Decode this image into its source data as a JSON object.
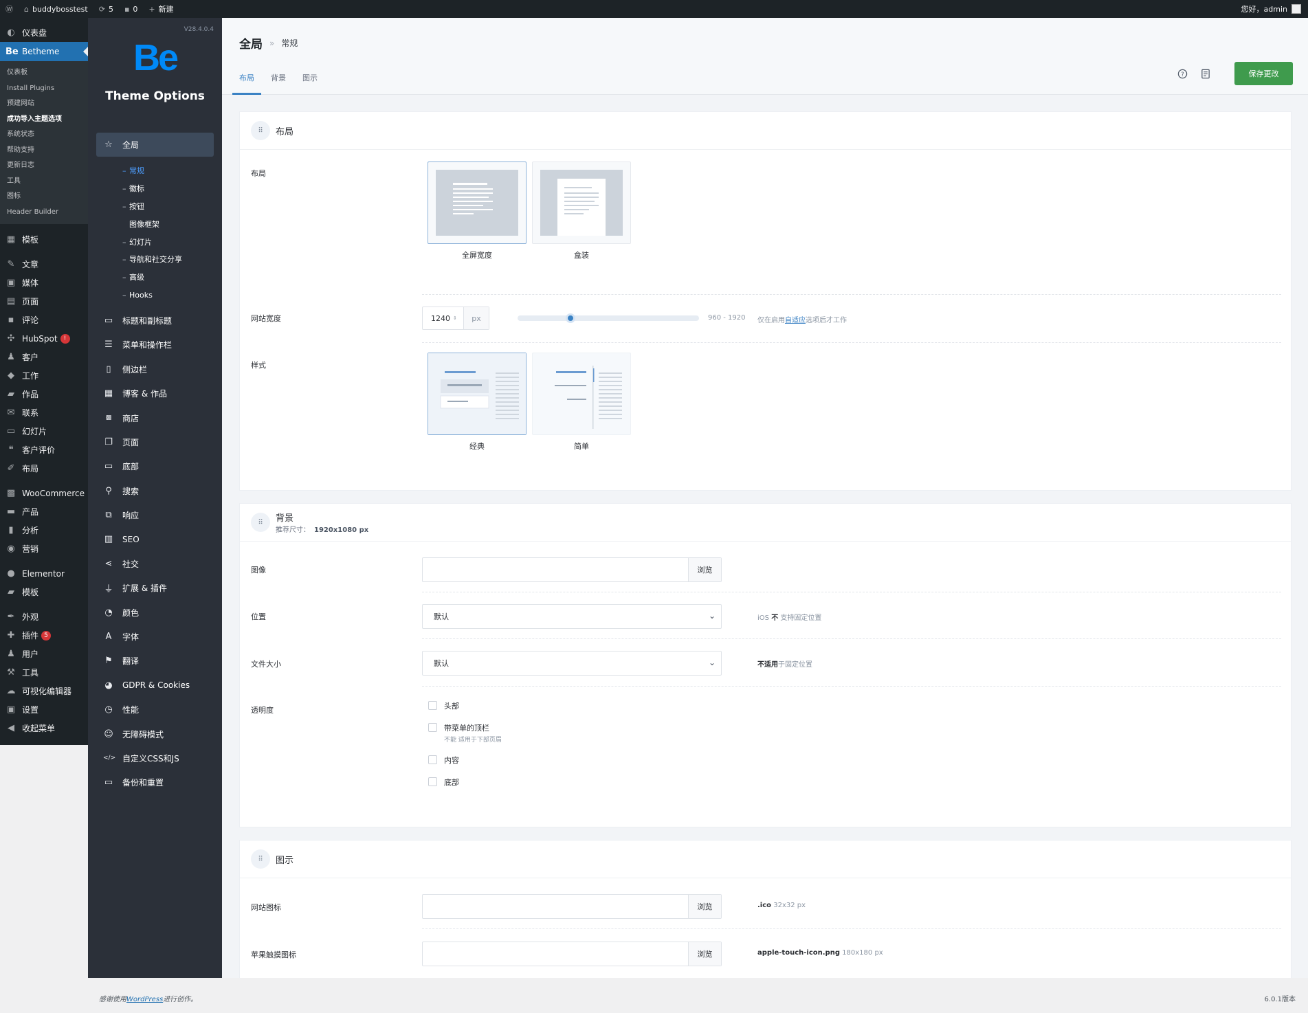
{
  "adminbar": {
    "site_name": "buddybosstest",
    "updates_count": "5",
    "comments_count": "0",
    "new_label": "新建",
    "greeting": "您好，admin"
  },
  "wp_menu": {
    "dashboard": "仪表盘",
    "betheme": "Betheme",
    "betheme_sub": [
      "仪表板",
      "Install Plugins",
      "预建网站",
      "成功导入主题选项",
      "系统状态",
      "帮助支持",
      "更新日志",
      "工具",
      "图标",
      "Header Builder"
    ],
    "group1": [
      {
        "label": "模板",
        "icon": "template-icon"
      }
    ],
    "group2": [
      {
        "label": "文章",
        "icon": "pin-icon"
      },
      {
        "label": "媒体",
        "icon": "media-icon"
      },
      {
        "label": "页面",
        "icon": "page-icon"
      },
      {
        "label": "评论",
        "icon": "comment-icon"
      },
      {
        "label": "HubSpot",
        "icon": "hubspot-icon",
        "badge": "!"
      },
      {
        "label": "客户",
        "icon": "client-icon"
      },
      {
        "label": "工作",
        "icon": "work-icon"
      },
      {
        "label": "作品",
        "icon": "portfolio-icon"
      },
      {
        "label": "联系",
        "icon": "mail-icon"
      },
      {
        "label": "幻灯片",
        "icon": "slides-icon"
      },
      {
        "label": "客户评价",
        "icon": "quote-icon"
      },
      {
        "label": "布局",
        "icon": "layout-icon"
      }
    ],
    "group3": [
      {
        "label": "WooCommerce",
        "icon": "woo-icon"
      },
      {
        "label": "产品",
        "icon": "product-icon"
      },
      {
        "label": "分析",
        "icon": "analytics-icon"
      },
      {
        "label": "营销",
        "icon": "marketing-icon"
      }
    ],
    "group4": [
      {
        "label": "Elementor",
        "icon": "elementor-icon"
      },
      {
        "label": "模板",
        "icon": "folder-icon"
      }
    ],
    "group5": [
      {
        "label": "外观",
        "icon": "brush-icon"
      },
      {
        "label": "插件",
        "icon": "plugin-icon",
        "badge": "5"
      },
      {
        "label": "用户",
        "icon": "user-icon"
      },
      {
        "label": "工具",
        "icon": "wrench-icon"
      },
      {
        "label": "可视化编辑器",
        "icon": "editor-icon"
      },
      {
        "label": "设置",
        "icon": "settings-icon"
      },
      {
        "label": "收起菜单",
        "icon": "collapse-icon"
      }
    ]
  },
  "be_sidebar": {
    "version": "V28.4.0.4",
    "logo": "Be",
    "title": "Theme Options",
    "active_item": "全局",
    "subitems": [
      {
        "label": "常规",
        "dash": true,
        "active": true
      },
      {
        "label": "徽标",
        "dash": true
      },
      {
        "label": "按钮",
        "dash": true
      },
      {
        "label": "图像框架",
        "dash": false
      },
      {
        "label": "幻灯片",
        "dash": true
      },
      {
        "label": "导航和社交分享",
        "dash": true
      },
      {
        "label": "高级",
        "dash": true
      },
      {
        "label": "Hooks",
        "dash": true
      }
    ],
    "items": [
      {
        "label": "标题和副标题",
        "icon": "header-icon"
      },
      {
        "label": "菜单和操作栏",
        "icon": "menu-icon"
      },
      {
        "label": "侧边栏",
        "icon": "sidebar-icon"
      },
      {
        "label": "博客 & 作品",
        "icon": "blog-icon"
      },
      {
        "label": "商店",
        "icon": "woo-icon"
      },
      {
        "label": "页面",
        "icon": "pages-icon"
      },
      {
        "label": "底部",
        "icon": "footer-icon"
      },
      {
        "label": "搜索",
        "icon": "search-icon"
      },
      {
        "label": "响应",
        "icon": "responsive-icon"
      },
      {
        "label": "SEO",
        "icon": "seo-icon"
      },
      {
        "label": "社交",
        "icon": "share-icon"
      },
      {
        "label": "扩展 & 插件",
        "icon": "plug-icon"
      },
      {
        "label": "颜色",
        "icon": "palette-icon"
      },
      {
        "label": "字体",
        "icon": "font-icon"
      },
      {
        "label": "翻译",
        "icon": "flag-icon"
      },
      {
        "label": "GDPR & Cookies",
        "icon": "cookie-icon"
      },
      {
        "label": "性能",
        "icon": "speed-icon"
      },
      {
        "label": "无障碍模式",
        "icon": "accessibility-icon"
      },
      {
        "label": "自定义CSS和JS",
        "icon": "code-icon"
      },
      {
        "label": "备份和重置",
        "icon": "backup-icon"
      }
    ]
  },
  "header": {
    "breadcrumb_main": "全局",
    "breadcrumb_sep": "»",
    "breadcrumb_sub": "常规",
    "tabs": [
      "布局",
      "背景",
      "图示"
    ],
    "save_label": "保存更改"
  },
  "layout_card": {
    "title": "布局",
    "layout_label": "布局",
    "layout_options": [
      "全屏宽度",
      "盒装"
    ],
    "width_label": "网站宽度",
    "width_value": "1240",
    "width_unit": "px",
    "width_range": "960 - 1920",
    "width_min": 960,
    "width_max": 1920,
    "width_hint_pre": "仅在启用",
    "width_hint_link": "自适应",
    "width_hint_post": "选项后才工作",
    "style_label": "样式",
    "style_options": [
      "经典",
      "简单"
    ]
  },
  "background_card": {
    "title": "背景",
    "subtitle": "推荐尺寸：",
    "subtitle_size": "1920x1080 px",
    "image_label": "图像",
    "browse": "浏览",
    "position_label": "位置",
    "position_value": "默认",
    "position_hint_pre": "iOS",
    "position_hint_bold": "不",
    "position_hint_post": "支持固定位置",
    "size_label": "文件大小",
    "size_value": "默认",
    "size_hint_bold": "不适用",
    "size_hint_post": "于固定位置",
    "transparency_label": "透明度",
    "checkboxes": [
      {
        "label": "头部",
        "note": ""
      },
      {
        "label": "带菜单的顶栏",
        "note": "不能 适用于下部页眉"
      },
      {
        "label": "内容",
        "note": ""
      },
      {
        "label": "底部",
        "note": ""
      }
    ]
  },
  "icon_card": {
    "title": "图示",
    "favicon_label": "网站图标",
    "favicon_hint_bold": ".ico",
    "favicon_hint": "32x32 px",
    "apple_label": "苹果触摸图标",
    "apple_hint_bold": "apple-touch-icon.png",
    "apple_hint": "180x180 px",
    "browse": "浏览"
  },
  "footer": {
    "thanks_pre": "感谢使用",
    "thanks_link": "WordPress",
    "thanks_post": "进行创作。",
    "version": "6.0.1版本"
  }
}
